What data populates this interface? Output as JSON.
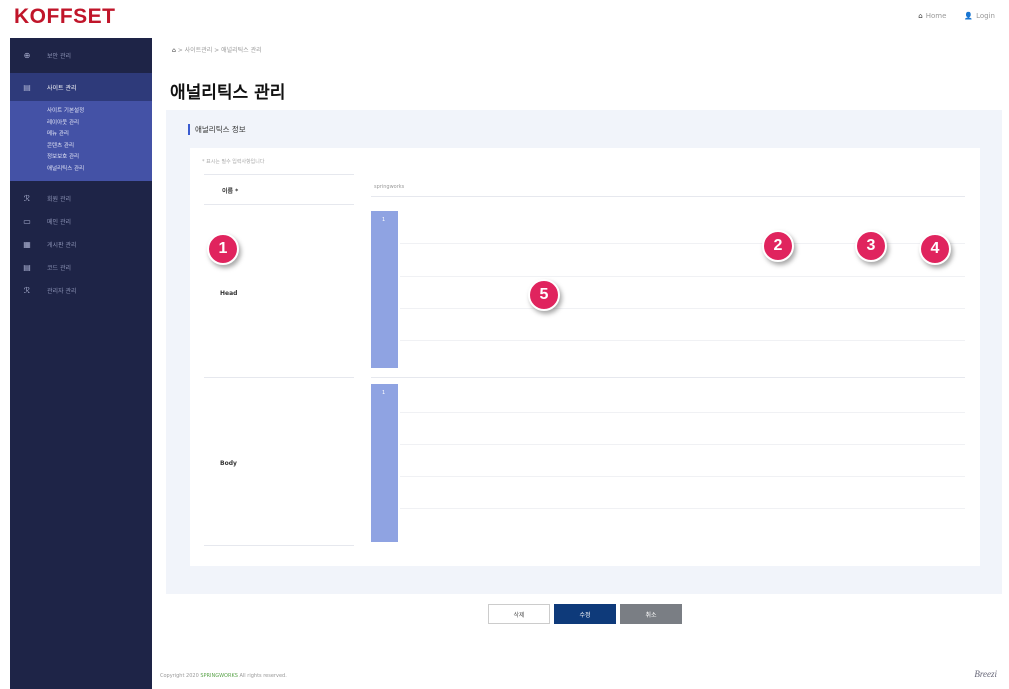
{
  "header": {
    "logo": "KOFFSET",
    "home_icon": "home-icon",
    "home_label": "Home",
    "login_icon": "user-icon",
    "login_label": "Login"
  },
  "sidebar": {
    "items": [
      {
        "label": "보안 관리",
        "icon": "shield-icon"
      },
      {
        "label": "사이트 관리",
        "icon": "site-icon"
      },
      {
        "label": "회원 관리",
        "icon": "members-icon"
      },
      {
        "label": "메인 관리",
        "icon": "monitor-icon"
      },
      {
        "label": "게시판 관리",
        "icon": "board-icon"
      },
      {
        "label": "코드 관리",
        "icon": "code-icon"
      },
      {
        "label": "관리자 관리",
        "icon": "admin-icon"
      }
    ],
    "subitems": [
      "사이트 기본설정",
      "레이아웃 관리",
      "메뉴 관리",
      "콘텐츠 관리",
      "정보보호 관리",
      "애널리틱스 관리"
    ]
  },
  "breadcrumb": "사이트관리 > 애널리틱스 관리",
  "page": {
    "title": "애널리틱스 관리",
    "section_title": "애널리틱스 정보",
    "note": "* 표시는 필수 입력사항입니다",
    "name_label": "이름 *",
    "name_value": "springworks",
    "head_label": "Head",
    "body_label": "Body"
  },
  "badges": [
    "1",
    "2",
    "3",
    "4",
    "5"
  ],
  "buttons": {
    "delete": "삭제",
    "edit": "수정",
    "cancel": "취소"
  },
  "footer": {
    "copyright_pre": "Copyright 2020",
    "brand": "SPRINGWORKS",
    "copyright_post": "All rights reserved.",
    "logo": "Breezi"
  },
  "colors": {
    "brand": "#c0152a",
    "sidebar": "#1e2447",
    "submenu": "#4452a6",
    "badge": "#e0245e",
    "primary": "#0e3a7a"
  }
}
